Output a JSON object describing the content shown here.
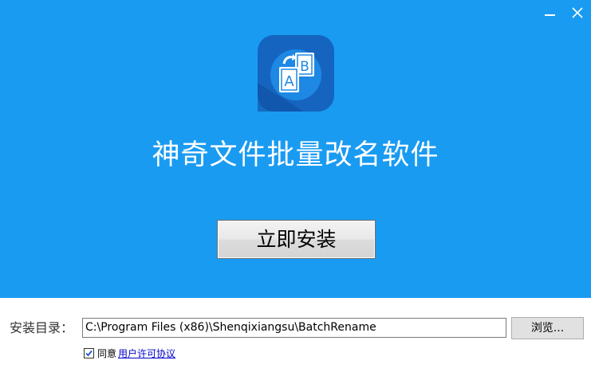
{
  "window": {
    "minimize_icon": "minimize-icon",
    "close_icon": "close-icon"
  },
  "hero": {
    "background_color": "#1a9bf2",
    "app_icon": "rename-files-app-icon",
    "app_title": "神奇文件批量改名软件",
    "install_button_label": "立即安装"
  },
  "install_dir": {
    "label": "安装目录：",
    "path_value": "C:\\Program Files (x86)\\Shenqixiangsu\\BatchRename",
    "browse_button_label": "浏览..."
  },
  "agreement": {
    "checked": true,
    "agree_text": "同意",
    "license_link_text": "用户许可协议"
  }
}
